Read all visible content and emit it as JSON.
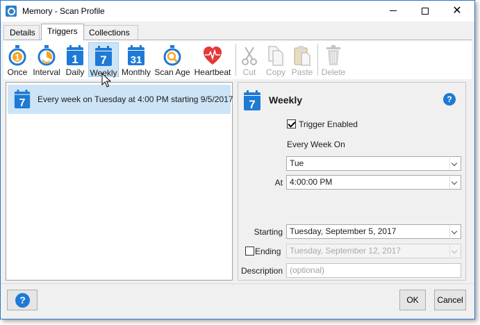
{
  "window": {
    "title": "Memory - Scan Profile"
  },
  "tabs": [
    {
      "label": "Details"
    },
    {
      "label": "Triggers"
    },
    {
      "label": "Collections"
    }
  ],
  "toolbar": {
    "items": [
      {
        "label": "Once",
        "icon": "stopwatch-once-icon",
        "enabled": true
      },
      {
        "label": "Interval",
        "icon": "stopwatch-interval-icon",
        "enabled": true
      },
      {
        "label": "Daily",
        "icon": "calendar-daily-icon",
        "glyph": "1",
        "enabled": true
      },
      {
        "label": "Weekly",
        "icon": "calendar-weekly-icon",
        "glyph": "7",
        "enabled": true
      },
      {
        "label": "Monthly",
        "icon": "calendar-monthly-icon",
        "glyph": "31",
        "enabled": true
      },
      {
        "label": "Scan Age",
        "icon": "stopwatch-search-icon",
        "enabled": true
      },
      {
        "label": "Heartbeat",
        "icon": "heartbeat-icon",
        "enabled": true
      },
      {
        "label": "Cut",
        "icon": "scissors-icon",
        "enabled": false
      },
      {
        "label": "Copy",
        "icon": "copy-icon",
        "enabled": false
      },
      {
        "label": "Paste",
        "icon": "paste-icon",
        "enabled": false
      },
      {
        "label": "Delete",
        "icon": "trash-icon",
        "enabled": false
      }
    ]
  },
  "triggers": [
    {
      "glyph": "7",
      "text": "Every week on Tuesday at 4:00 PM starting 9/5/2017"
    }
  ],
  "detail": {
    "glyph": "7",
    "title": "Weekly",
    "help": "?",
    "trigger_enabled_label": "Trigger Enabled",
    "trigger_enabled": true,
    "every_week_on_label": "Every Week On",
    "day_value": "Tue",
    "at_label": "At",
    "time_value": "4:00:00 PM",
    "starting_label": "Starting",
    "starting_value": "Tuesday, September 5, 2017",
    "ending_label": "Ending",
    "ending_checked": false,
    "ending_value": "Tuesday, September 12, 2017",
    "description_label": "Description",
    "description_placeholder": "(optional)"
  },
  "footer": {
    "help": "?",
    "ok": "OK",
    "cancel": "Cancel"
  },
  "colors": {
    "accent": "#1e7ad4",
    "selection": "#cde4f7",
    "heart": "#e23a3a",
    "stopwatch_orange": "#f5a623"
  }
}
